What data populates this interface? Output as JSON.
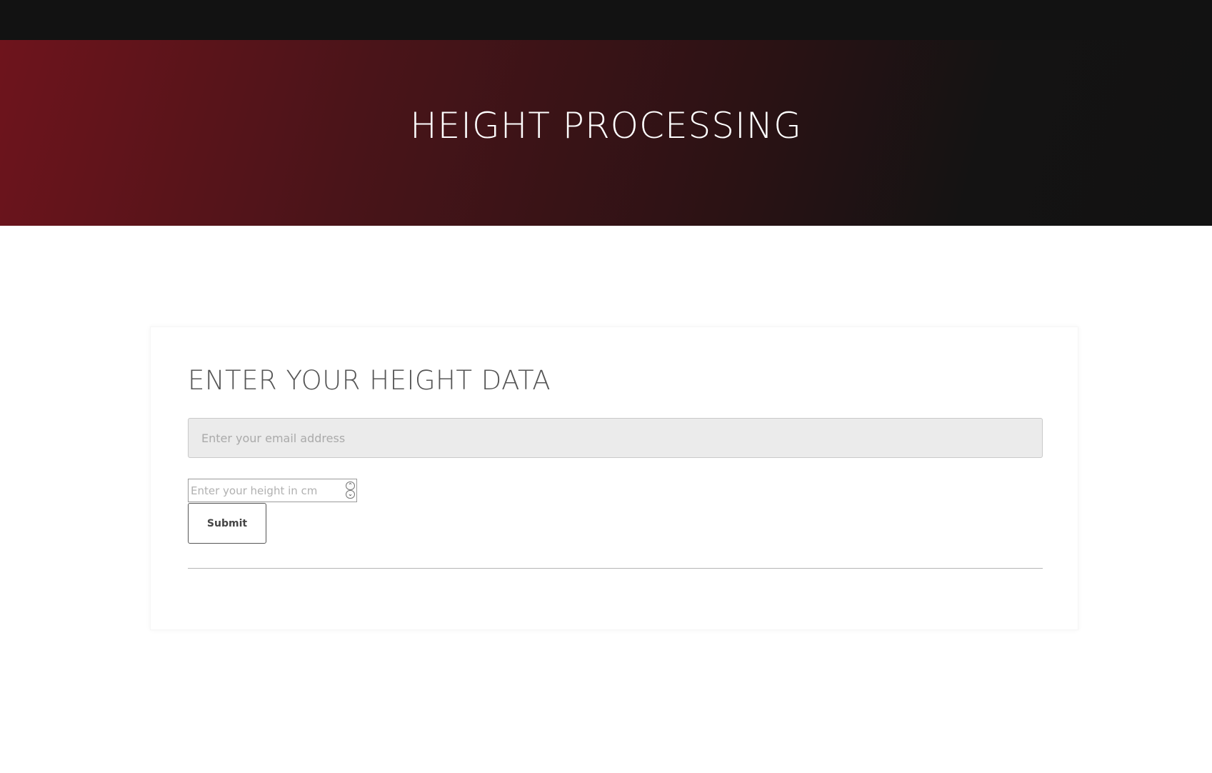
{
  "header": {
    "title": "HEIGHT PROCESSING"
  },
  "form": {
    "title": "ENTER YOUR HEIGHT DATA",
    "email_placeholder": "Enter your email address",
    "email_value": "",
    "height_placeholder": "Enter your height in cm",
    "height_value": "",
    "spinner_up": "⌃",
    "spinner_down": "⌄",
    "submit_label": "Submit"
  },
  "colors": {
    "topbar": "#121212",
    "hero_gradient_start": "#6e141c",
    "hero_gradient_end": "#121212",
    "email_field_bg": "#ebebeb"
  }
}
